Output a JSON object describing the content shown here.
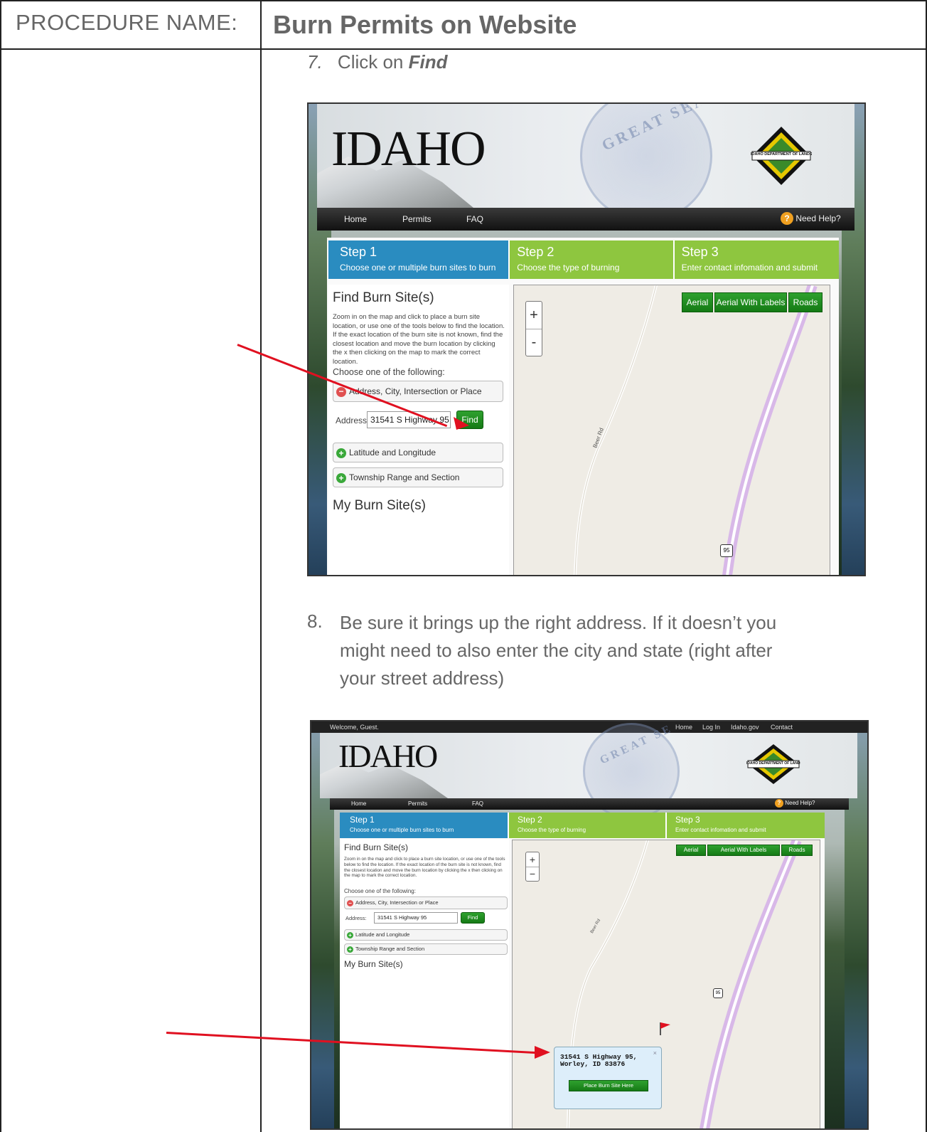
{
  "header": {
    "procedure_label": "PROCEDURE NAME:",
    "procedure_title": "Burn Permits on Website"
  },
  "steps": {
    "step7": {
      "number": "7.",
      "prefix": "Click on ",
      "emphasis": "Find"
    },
    "step8": {
      "number": "8.",
      "lines": [
        "Be sure it brings up the right address.  If it doesn’t you",
        "might need to also enter the city and state (right after",
        "your street address)"
      ]
    }
  },
  "shot1": {
    "logo": "IDAHO",
    "seal_text": "GREAT SEAL OF THE",
    "dept_logo": "IDAHO DEPARTMENT OF LANDS",
    "nav": [
      "Home",
      "Permits",
      "FAQ"
    ],
    "help": "Need Help?",
    "wizard": [
      {
        "title": "Step 1",
        "sub": "Choose one or multiple burn sites to burn"
      },
      {
        "title": "Step 2",
        "sub": "Choose the type of burning"
      },
      {
        "title": "Step 3",
        "sub": "Enter contact infomation and submit"
      }
    ],
    "panel_title": "Find Burn Site(s)",
    "panel_desc": "Zoom in on the map and click to place a burn site location, or use one of the tools below to find the location. If the exact location of the burn site is not known, find the closest location and move the burn location by clicking the x then clicking on the map to mark the correct location.",
    "choose": "Choose one of the following:",
    "acc_address": "Address, City, Intersection or Place",
    "address_label": "Address:",
    "address_value": "31541 S Highway 95",
    "find": "Find",
    "acc_latlon": "Latitude and Longitude",
    "acc_trs": "Township Range and Section",
    "my_sites": "My Burn Site(s)",
    "map_buttons": [
      "Aerial",
      "Aerial With Labels",
      "Roads"
    ],
    "zoom_in": "+",
    "zoom_out": "-",
    "road_label": "Beer Rd",
    "shield": "95"
  },
  "shot2": {
    "welcome": "Welcome, Guest.",
    "top_links": [
      "Home",
      "Log In",
      "Idaho.gov",
      "Contact"
    ],
    "logo": "IDAHO",
    "seal_text": "GREAT SEAL OF THE",
    "dept_logo": "IDAHO DEPARTMENT OF LANDS",
    "nav": [
      "Home",
      "Permits",
      "FAQ"
    ],
    "help": "Need Help?",
    "wizard": [
      {
        "title": "Step 1",
        "sub": "Choose one or multiple burn sites to burn"
      },
      {
        "title": "Step 2",
        "sub": "Choose the type of burning"
      },
      {
        "title": "Step 3",
        "sub": "Enter contact infomation and submit"
      }
    ],
    "panel_title": "Find Burn Site(s)",
    "panel_desc": "Zoom in on the map and click to place a burn site location, or use one of the tools below to find the location. If the exact location of the burn site is not known, find the closest location and move the burn location by clicking the x then clicking on the map to mark the correct location.",
    "choose": "Choose one of the following:",
    "acc_address": "Address, City, Intersection or Place",
    "address_label": "Address:",
    "address_value": "31541 S Highway 95",
    "find": "Find",
    "acc_latlon": "Latitude and Longitude",
    "acc_trs": "Township Range and Section",
    "my_sites": "My Burn Site(s)",
    "map_buttons": [
      "Aerial",
      "Aerial With Labels",
      "Roads"
    ],
    "zoom_in": "+",
    "zoom_out": "−",
    "road_label": "Beer Rd",
    "shield": "95",
    "popup_line1": "31541 S Highway 95,",
    "popup_line2": "Worley, ID 83876",
    "popup_close": "×",
    "place_btn": "Place Burn Site Here"
  },
  "colors": {
    "arrow": "#e01020",
    "step_blue": "#2a8cc0",
    "step_green": "#8ec63f",
    "button_green": "#1f8f1f"
  }
}
